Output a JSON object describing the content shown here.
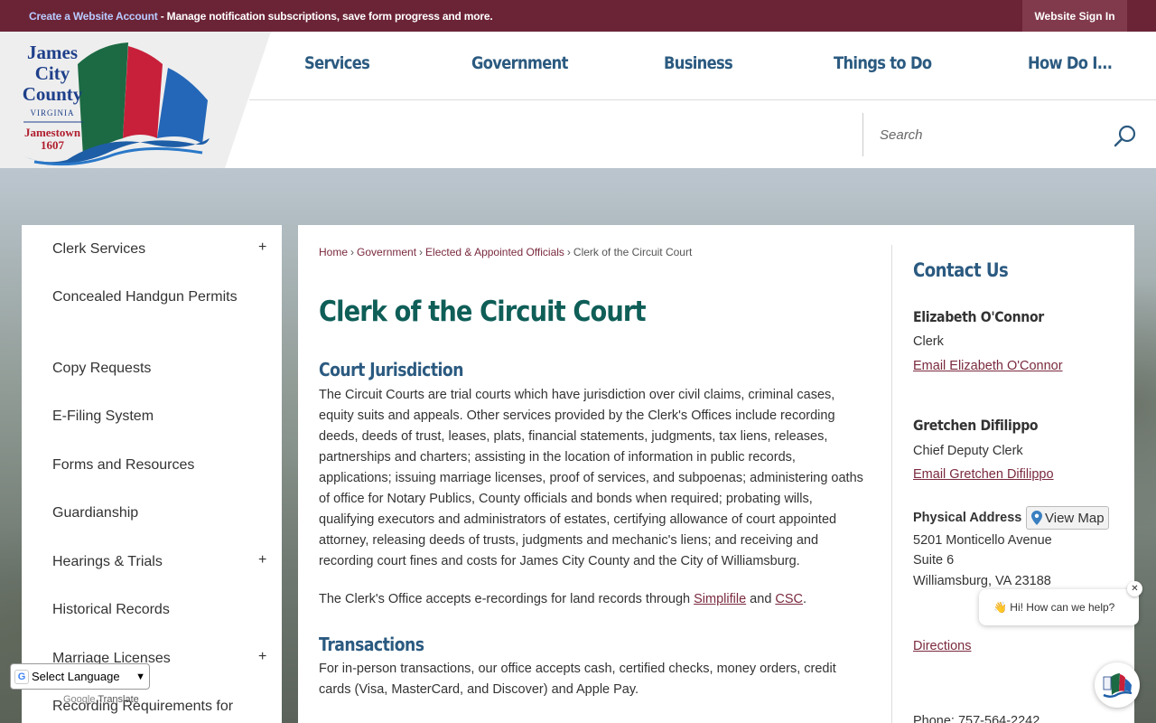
{
  "topbar": {
    "create_link": "Create a Website Account",
    "message": " - Manage notification subscriptions, save form progress and more.",
    "sign_in": "Website Sign In"
  },
  "logo": {
    "line1": "James",
    "line2": "City",
    "line3": "County",
    "line4": "VIRGINIA",
    "line5": "Jamestown",
    "line6": "1607"
  },
  "nav": [
    {
      "label": "Services"
    },
    {
      "label": "Government"
    },
    {
      "label": "Business"
    },
    {
      "label": "Things to Do"
    },
    {
      "label": "How Do I..."
    }
  ],
  "search": {
    "placeholder": "Search"
  },
  "sidebar": {
    "items": [
      {
        "label": "Clerk Services",
        "toggle": "+"
      },
      {
        "label": "Concealed Handgun Permits"
      },
      {
        "label": "Copy Requests"
      },
      {
        "label": "E-Filing System"
      },
      {
        "label": "Forms and Resources"
      },
      {
        "label": "Guardianship"
      },
      {
        "label": "Hearings & Trials",
        "toggle": "+"
      },
      {
        "label": "Historical Records"
      },
      {
        "label": "Marriage Licenses",
        "toggle": "+"
      },
      {
        "label": "Recording Requirements for"
      }
    ]
  },
  "breadcrumb": {
    "items": [
      "Home",
      "Government",
      "Elected & Appointed Officials"
    ],
    "current": "Clerk of the Circuit Court",
    "separator": "›"
  },
  "main": {
    "title": "Clerk of the Circuit Court",
    "section1_heading": "Court Jurisdiction",
    "section1_text": "The Circuit Courts are trial courts which have jurisdiction over civil claims, criminal cases, equity suits and appeals. Other services provided by the Clerk's Offices include recording deeds, deeds of trust, leases, plats, financial statements, judgments, tax liens, releases, partnerships and charters; assisting in the location of information in public records, applications; issuing marriage licenses, proof of services, and subpoenas; administering oaths of office for Notary Publics, County officials and bonds when required; probating wills, qualifying executors and administrators of estates, certifying allowance of court appointed attorney, releasing deeds of trusts, judgments and mechanic's liens; and receiving and recording court fines and costs for James City County and the City of Williamsburg.",
    "erecord_prefix": "The Clerk's Office accepts e-recordings for land records through ",
    "erecord_link1": "Simplifile",
    "erecord_and": " and ",
    "erecord_link2": "CSC",
    "erecord_suffix": ".",
    "section2_heading": "Transactions",
    "section2_text": "For in-person transactions, our office accepts cash, certified checks, money orders, credit cards (Visa, MasterCard, and Discover) and Apple Pay."
  },
  "contact": {
    "heading": "Contact Us",
    "person1": {
      "name": "Elizabeth O'Connor",
      "title": "Clerk",
      "email": "Email Elizabeth O'Connor"
    },
    "person2": {
      "name": "Gretchen Difilippo",
      "title": "Chief Deputy Clerk",
      "email": "Email Gretchen Difilippo"
    },
    "address_label": "Physical Address",
    "view_map": "View Map",
    "address_line1": "5201 Monticello Avenue",
    "address_line2": "Suite 6",
    "address_line3": "Williamsburg, VA 23188",
    "directions": "Directions",
    "phone": "Phone: 757-564-2242"
  },
  "chat": {
    "greeting": "👋 Hi! How can we help?",
    "close": "✕"
  },
  "translate": {
    "select_label": "Select Language",
    "powered_by": "Google",
    "translate_word": "Translate"
  },
  "colors": {
    "topbar": "#6b2336",
    "nav": "#2b5a80",
    "title": "#0f5e58",
    "link": "#7a2a3e"
  }
}
